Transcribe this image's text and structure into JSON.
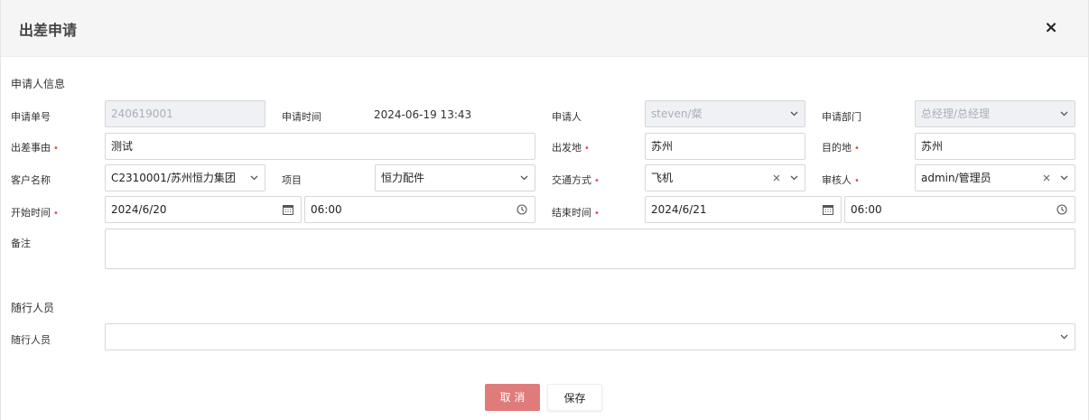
{
  "dialog": {
    "title": "出差申请",
    "close_glyph": "×"
  },
  "sections": {
    "applicant_info": "申请人信息",
    "companions": "随行人员"
  },
  "colors": {
    "cancel_button_bg": "#e07b7b",
    "required_star": "#e24b4b",
    "header_bg": "#f5f5f5",
    "disabled_field_bg": "#eff1f4"
  },
  "form": {
    "request_no": {
      "label": "申请单号",
      "value": "240619001"
    },
    "request_time": {
      "label": "申请时间",
      "value": "2024-06-19 13:43"
    },
    "applicant": {
      "label": "申请人",
      "value": "steven/粲"
    },
    "department": {
      "label": "申请部门",
      "value": "总经理/总经理"
    },
    "reason": {
      "label": "出差事由",
      "required_mark": "•",
      "value": "测试"
    },
    "origin": {
      "label": "出发地",
      "required_mark": "•",
      "value": "苏州"
    },
    "destination": {
      "label": "目的地",
      "required_mark": "•",
      "value": "苏州"
    },
    "customer": {
      "label": "客户名称",
      "value": "C2310001/苏州恒力集团"
    },
    "project": {
      "label": "项目",
      "value": "恒力配件"
    },
    "transport": {
      "label": "交通方式",
      "required_mark": "•",
      "value": "飞机"
    },
    "approver": {
      "label": "审核人",
      "required_mark": "•",
      "value": "admin/管理员"
    },
    "start": {
      "label": "开始时间",
      "required_mark": "•",
      "date": "2024/6/20",
      "time": "06:00"
    },
    "end": {
      "label": "结束时间",
      "required_mark": "•",
      "date": "2024/6/21",
      "time": "06:00"
    },
    "remark": {
      "label": "备注",
      "value": ""
    },
    "companions": {
      "label": "随行人员",
      "value": ""
    }
  },
  "buttons": {
    "cancel": "取 消",
    "save": "保存"
  },
  "icons": {
    "close": "close-icon",
    "dropdown": "chevron-down-icon",
    "clear": "clear-x-icon",
    "calendar": "calendar-icon",
    "clock": "clock-icon"
  }
}
